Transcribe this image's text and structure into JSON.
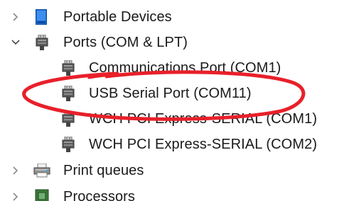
{
  "tree": {
    "categories": [
      {
        "label": "Portable Devices",
        "expanded": false,
        "icon": "portable-device-icon"
      },
      {
        "label": "Ports (COM & LPT)",
        "expanded": true,
        "icon": "port-icon"
      },
      {
        "label": "Print queues",
        "expanded": false,
        "icon": "printer-icon"
      },
      {
        "label": "Processors",
        "expanded": false,
        "icon": "processor-icon"
      }
    ],
    "ports": [
      {
        "label": "Communications Port (COM1)",
        "icon": "port-icon"
      },
      {
        "label": "USB Serial Port (COM11)",
        "icon": "port-icon",
        "highlighted": true
      },
      {
        "label": "WCH PCI Express-SERIAL (COM1)",
        "icon": "port-icon"
      },
      {
        "label": "WCH PCI Express-SERIAL (COM2)",
        "icon": "port-icon"
      }
    ]
  },
  "colors": {
    "annotation": "#e8202a",
    "chevron": "#8a8a8a",
    "text": "#1a1a1a"
  }
}
